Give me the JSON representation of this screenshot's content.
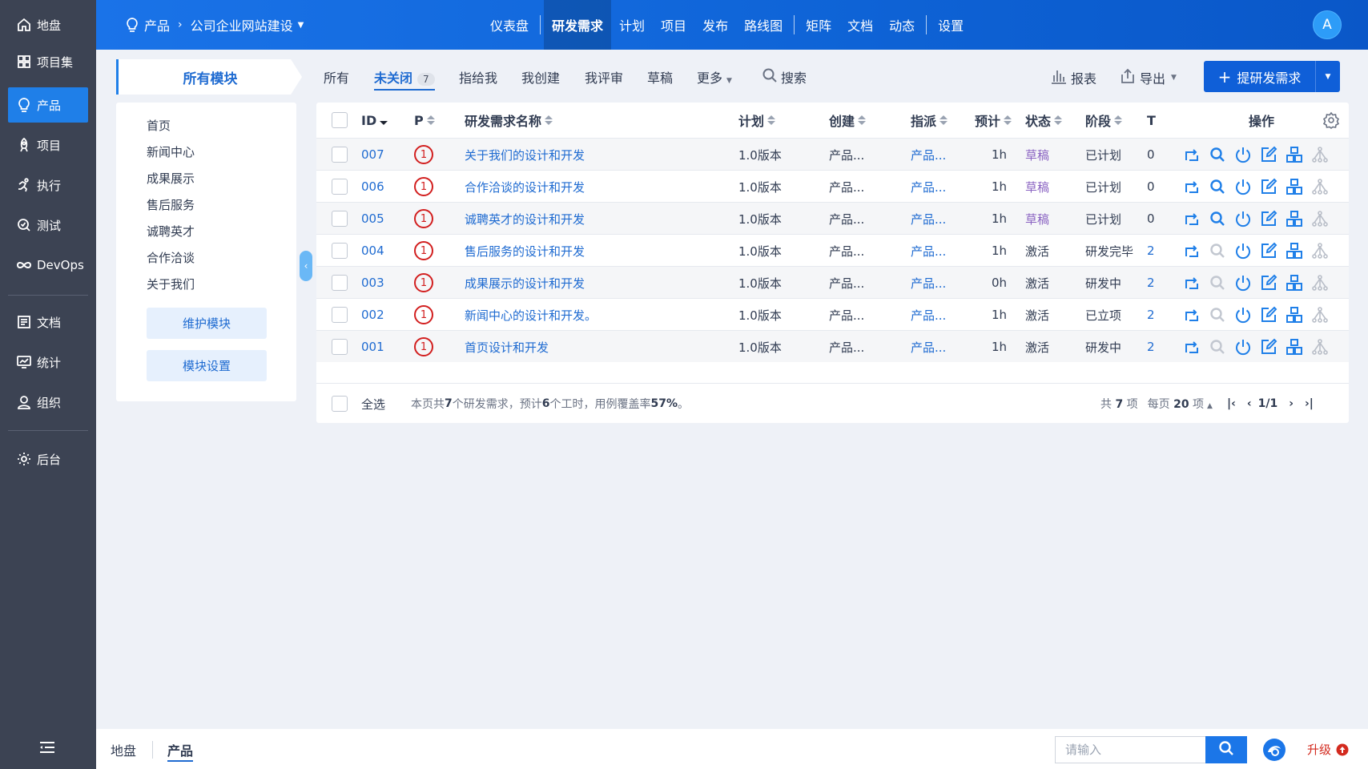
{
  "sidebar": {
    "items": [
      {
        "label": "地盘",
        "icon": "home-icon"
      },
      {
        "label": "项目集",
        "icon": "grid-icon"
      },
      {
        "label": "产品",
        "icon": "lightbulb-icon"
      },
      {
        "label": "项目",
        "icon": "rocket-icon"
      },
      {
        "label": "执行",
        "icon": "run-icon"
      },
      {
        "label": "测试",
        "icon": "test-icon"
      },
      {
        "label": "DevOps",
        "icon": "infinity-icon"
      },
      {
        "label": "文档",
        "icon": "doc-icon"
      },
      {
        "label": "统计",
        "icon": "chart-icon"
      },
      {
        "label": "组织",
        "icon": "user-icon"
      },
      {
        "label": "后台",
        "icon": "gear-icon"
      }
    ]
  },
  "header": {
    "product_label": "产品",
    "project_label": "公司企业网站建设",
    "nav": [
      "仪表盘",
      "研发需求",
      "计划",
      "项目",
      "发布",
      "路线图",
      "矩阵",
      "文档",
      "动态",
      "设置"
    ],
    "avatar": "A",
    "accent": "#1a73e8"
  },
  "modules": {
    "title": "所有模块",
    "items": [
      "首页",
      "新闻中心",
      "成果展示",
      "售后服务",
      "诚聘英才",
      "合作洽谈",
      "关于我们"
    ],
    "maintain_button": "维护模块",
    "settings_button": "模块设置"
  },
  "toolbar": {
    "tabs": [
      "所有",
      "未关闭",
      "指给我",
      "我创建",
      "我评审",
      "草稿",
      "更多"
    ],
    "badge": "7",
    "search": "搜索",
    "report": "报表",
    "export": "导出",
    "create": "提研发需求"
  },
  "table": {
    "headers": {
      "id": "ID",
      "p": "P",
      "name": "研发需求名称",
      "plan": "计划",
      "creator": "创建",
      "assignee": "指派",
      "estimate": "预计",
      "status": "状态",
      "stage": "阶段",
      "t": "T",
      "ops": "操作"
    },
    "rows": [
      {
        "id": "007",
        "pri": "1",
        "name": "关于我们的设计和开发",
        "plan": "1.0版本",
        "creator": "产品...",
        "assignee": "产品...",
        "estimate": "1h",
        "status": "草稿",
        "stage": "已计划",
        "t": "0"
      },
      {
        "id": "006",
        "pri": "1",
        "name": "合作洽谈的设计和开发",
        "plan": "1.0版本",
        "creator": "产品...",
        "assignee": "产品...",
        "estimate": "1h",
        "status": "草稿",
        "stage": "已计划",
        "t": "0"
      },
      {
        "id": "005",
        "pri": "1",
        "name": "诚聘英才的设计和开发",
        "plan": "1.0版本",
        "creator": "产品...",
        "assignee": "产品...",
        "estimate": "1h",
        "status": "草稿",
        "stage": "已计划",
        "t": "0"
      },
      {
        "id": "004",
        "pri": "1",
        "name": "售后服务的设计和开发",
        "plan": "1.0版本",
        "creator": "产品...",
        "assignee": "产品...",
        "estimate": "1h",
        "status": "激活",
        "stage": "研发完毕",
        "t": "2"
      },
      {
        "id": "003",
        "pri": "1",
        "name": "成果展示的设计和开发",
        "plan": "1.0版本",
        "creator": "产品...",
        "assignee": "产品...",
        "estimate": "0h",
        "status": "激活",
        "stage": "研发中",
        "t": "2"
      },
      {
        "id": "002",
        "pri": "1",
        "name": "新闻中心的设计和开发。",
        "plan": "1.0版本",
        "creator": "产品...",
        "assignee": "产品...",
        "estimate": "1h",
        "status": "激活",
        "stage": "已立项",
        "t": "2"
      },
      {
        "id": "001",
        "pri": "1",
        "name": "首页设计和开发",
        "plan": "1.0版本",
        "creator": "产品...",
        "assignee": "产品...",
        "estimate": "1h",
        "status": "激活",
        "stage": "研发中",
        "t": "2"
      }
    ],
    "footer": {
      "select_all": "全选",
      "summary_parts": [
        "本页共 ",
        "7",
        " 个研发需求，预计 ",
        "6",
        " 个工时，用例覆盖率 ",
        "57%",
        "。"
      ],
      "total_prefix": "共 ",
      "total": "7",
      "total_suffix": " 项",
      "per_page_prefix": "每页 ",
      "per_page": "20",
      "per_page_suffix": " 项",
      "page": "1/1"
    }
  },
  "bottom": {
    "crumb_home": "地盘",
    "crumb_product": "产品",
    "search_placeholder": "请输入",
    "upgrade": "升级"
  }
}
